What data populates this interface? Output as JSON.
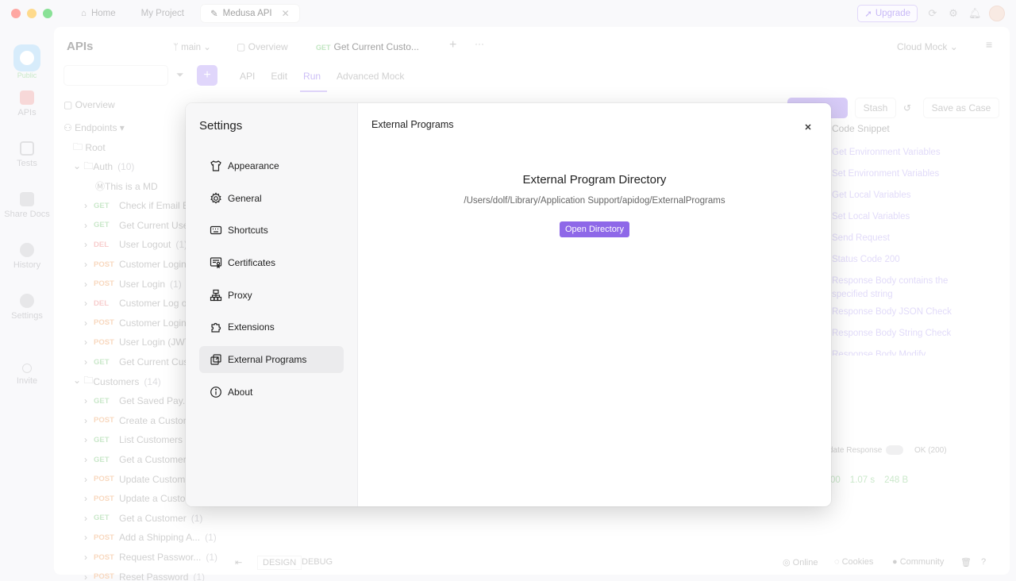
{
  "window": {
    "tabs": [
      {
        "label": "Home",
        "icon": "home-icon"
      },
      {
        "label": "My Project"
      },
      {
        "label": "Medusa API",
        "icon": "api-icon",
        "active": true
      }
    ],
    "upgrade_label": "Upgrade"
  },
  "rail": {
    "public_label": "Public",
    "items": [
      {
        "label": "APIs"
      },
      {
        "label": "Tests"
      },
      {
        "label": "Share Docs"
      },
      {
        "label": "History"
      },
      {
        "label": "Settings"
      },
      {
        "label": "Invite"
      }
    ]
  },
  "project": {
    "title": "APIs",
    "branch": "main",
    "overview_tab": "Overview",
    "current_tab_method": "GET",
    "current_tab": "Get Current Custo...",
    "env": "Cloud Mock",
    "run_tabs": [
      "API",
      "Edit",
      "Run",
      "Advanced Mock"
    ],
    "stash_label": "Stash",
    "save_case_label": "Save as Case",
    "code_snippet_label": "Code Snippet",
    "snippets": [
      "Get Environment Variables",
      "Set Environment Variables",
      "Get Local Variables",
      "Set Local Variables",
      "Send Request",
      "Status Code 200",
      "Response Body contains the",
      "specified string",
      "Response Body JSON Check",
      "Response Body String Check",
      "Response Body Modify"
    ],
    "response_toggle_label": "date Response",
    "response_status": "OK (200)",
    "response_metrics": [
      "00",
      "1.07 s",
      "248 B"
    ]
  },
  "tree": {
    "overview": "Overview",
    "endpoints": "Endpoints",
    "root": "Root",
    "rows": [
      {
        "type": "folder",
        "label": "Auth",
        "count": "(10)"
      },
      {
        "type": "doc",
        "label": "This is a MD"
      },
      {
        "method": "GET",
        "label": "Check if Email E"
      },
      {
        "method": "GET",
        "label": "Get Current Use"
      },
      {
        "method": "DEL",
        "label": "User Logout",
        "count": "(1)"
      },
      {
        "method": "POST",
        "label": "Customer Login"
      },
      {
        "method": "POST",
        "label": "User Login",
        "count": "(1)"
      },
      {
        "method": "DEL",
        "label": "Customer Log o"
      },
      {
        "method": "POST",
        "label": "Customer Login"
      },
      {
        "method": "POST",
        "label": "User Login (JWT"
      },
      {
        "method": "GET",
        "label": "Get Current Cus"
      },
      {
        "type": "folder",
        "label": "Customers",
        "count": "(14)"
      },
      {
        "method": "GET",
        "label": "Get Saved Pay..."
      },
      {
        "method": "POST",
        "label": "Create a Custon"
      },
      {
        "method": "GET",
        "label": "List Customers"
      },
      {
        "method": "GET",
        "label": "Get a Customer"
      },
      {
        "method": "POST",
        "label": "Update Custom"
      },
      {
        "method": "POST",
        "label": "Update a Custo"
      },
      {
        "method": "GET",
        "label": "Get a Customer",
        "count": "(1)"
      },
      {
        "method": "POST",
        "label": "Add a Shipping A...",
        "count": "(1)"
      },
      {
        "method": "POST",
        "label": "Request Passwor...",
        "count": "(1)"
      },
      {
        "method": "POST",
        "label": "Reset Password",
        "count": "(1)"
      }
    ]
  },
  "statusbar": {
    "design": "DESIGN",
    "debug": "DEBUG",
    "online": "Online",
    "cookies": "Cookies",
    "community": "Community"
  },
  "settings": {
    "title": "Settings",
    "menu": [
      {
        "label": "Appearance",
        "icon": "shirt-icon"
      },
      {
        "label": "General",
        "icon": "gear-icon"
      },
      {
        "label": "Shortcuts",
        "icon": "keyboard-icon"
      },
      {
        "label": "Certificates",
        "icon": "certificate-icon"
      },
      {
        "label": "Proxy",
        "icon": "network-icon"
      },
      {
        "label": "Extensions",
        "icon": "puzzle-icon"
      },
      {
        "label": "External Programs",
        "icon": "external-window-icon",
        "selected": true
      },
      {
        "label": "About",
        "icon": "info-icon"
      }
    ],
    "panel": {
      "title": "External Programs",
      "heading": "External Program Directory",
      "path": "/Users/dolf/Library/Application Support/apidog/ExternalPrograms",
      "button": "Open Directory"
    }
  },
  "colors": {
    "accent": "#8e68e8",
    "get": "#9fd59f",
    "post": "#f3b98a",
    "delete": "#f3a5a5"
  }
}
